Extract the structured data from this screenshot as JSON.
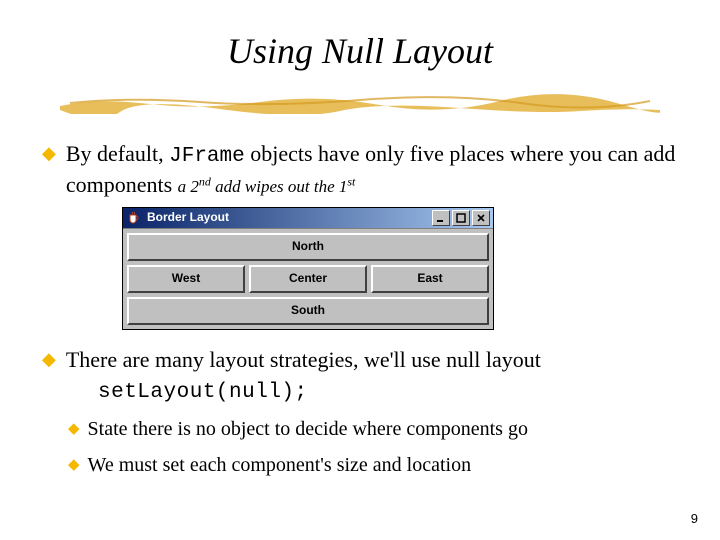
{
  "title": "Using Null Layout",
  "bullets": {
    "b1_pre": "By default, ",
    "b1_code": "JFrame",
    "b1_post": " objects have only five places where you can add components ",
    "b1_note_a": "a 2",
    "b1_note_sup1": "nd",
    "b1_note_b": " add wipes out the 1",
    "b1_note_sup2": "st",
    "b2": "There are many layout strategies, we'll use null layout",
    "code": "setLayout(null);",
    "s1": "State there is no object to decide where components go",
    "s2": "We must set each component's size and location"
  },
  "window": {
    "title": "Border Layout",
    "regions": {
      "north": "North",
      "west": "West",
      "center": "Center",
      "east": "East",
      "south": "South"
    }
  },
  "page_number": "9"
}
